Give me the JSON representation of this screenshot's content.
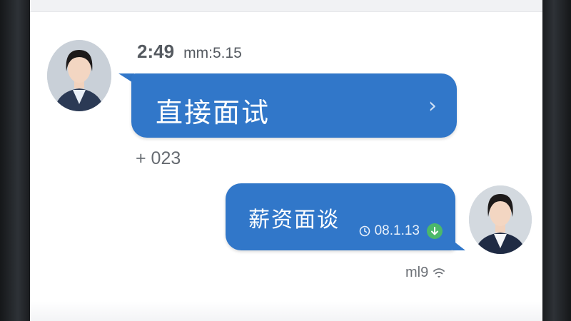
{
  "chat": {
    "header_time": "2:49",
    "header_meta": "mm:5.15",
    "incoming": {
      "text": "直接面试",
      "chevron": "›",
      "sub_label": "+ 023"
    },
    "outgoing": {
      "text": "薪资面谈",
      "timestamp": "08.1.13",
      "status_text": "ml9"
    }
  },
  "icons": {
    "incoming_chevron": "chevron-right-icon",
    "clock": "clock-icon",
    "download": "download-arrow-icon",
    "status": "signal-icon"
  },
  "colors": {
    "bubble": "#3177c9",
    "download_badge": "#4bb86a",
    "text_gray": "#666b71"
  }
}
